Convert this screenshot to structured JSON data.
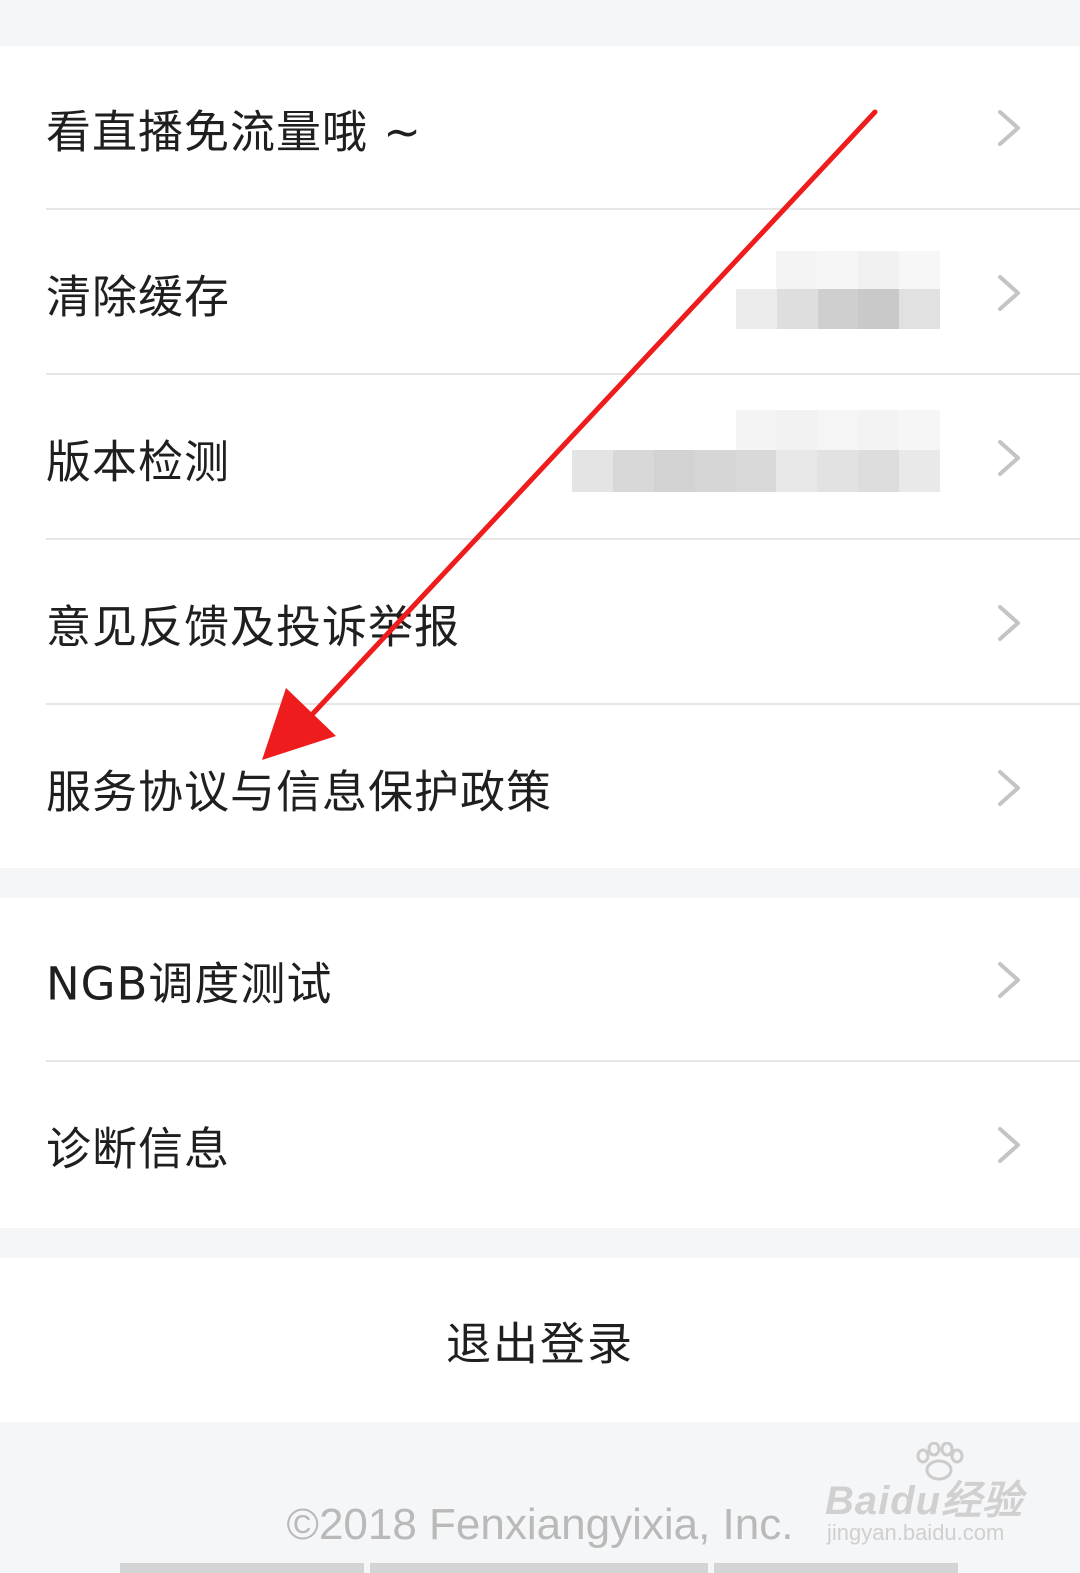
{
  "settings": {
    "group1": [
      {
        "label": "看直播免流量哦 ~"
      },
      {
        "label": "清除缓存"
      },
      {
        "label": "版本检测"
      },
      {
        "label": "意见反馈及投诉举报"
      },
      {
        "label": "服务协议与信息保护政策"
      }
    ],
    "group2": [
      {
        "label": "NGB调度测试"
      },
      {
        "label": "诊断信息"
      }
    ],
    "logout_label": "退出登录"
  },
  "footer": {
    "copyright": "©2018 Fenxiangyixia, Inc."
  },
  "watermark": {
    "brand": "Baidu经验",
    "url": "jingyan.baidu.com"
  },
  "colors": {
    "page_bg": "#f5f6f8",
    "row_bg": "#ffffff",
    "text": "#1f1f1f",
    "chevron": "#c4c4c4",
    "divider": "#e6e6e6",
    "annotation_arrow": "#ee1c1c"
  },
  "icons": {
    "row_chevron": "chevron-right-icon",
    "annotation": "red-arrow-annotation"
  }
}
